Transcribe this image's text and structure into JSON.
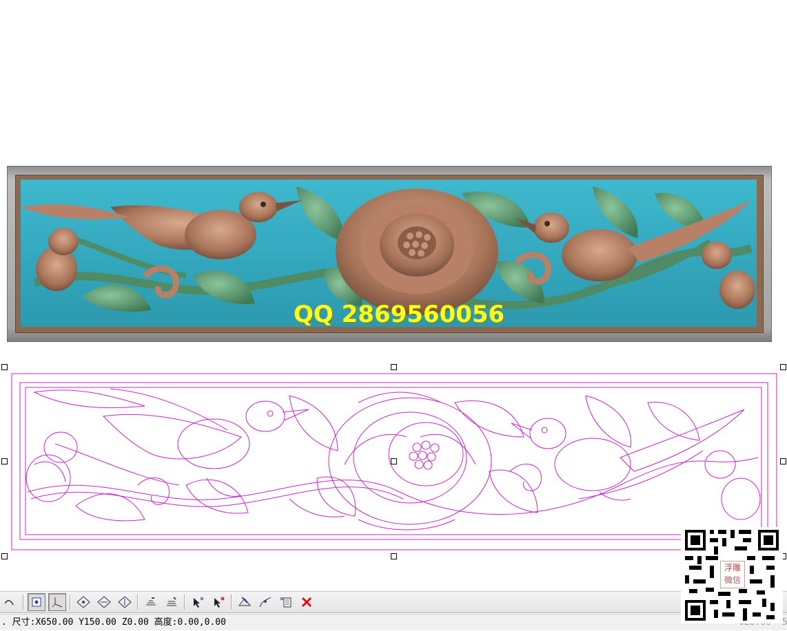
{
  "watermark": {
    "text": "QQ 2869560056",
    "color": "#ffff1a"
  },
  "relief": {
    "frame_color": "#8c6a52",
    "background_color": "#3fb9cf",
    "carving_color": "#b7856a",
    "leaf_color": "#5f9c72"
  },
  "vector": {
    "stroke_color": "#cc22cc"
  },
  "qr_code": {
    "label_line1": "浮雕",
    "label_line2": "微信"
  },
  "toolbar": {
    "buttons": [
      {
        "name": "curve-tool-icon",
        "active": false
      },
      {
        "name": "snap-point-icon",
        "active": true
      },
      {
        "name": "axis-icon",
        "active": true
      },
      {
        "name": "diamond-node-icon",
        "active": false
      },
      {
        "name": "diamond-edit-icon",
        "active": false
      },
      {
        "name": "diamond-transform-icon",
        "active": false
      },
      {
        "name": "layer-stack-icon",
        "active": false
      },
      {
        "name": "layer-edit-icon",
        "active": false
      },
      {
        "name": "select-cross-icon",
        "active": false
      },
      {
        "name": "select-delete-icon",
        "active": false
      },
      {
        "name": "node-edit-icon",
        "active": false
      },
      {
        "name": "path-edit-icon",
        "active": false
      },
      {
        "name": "document-edit-icon",
        "active": false
      },
      {
        "name": "delete-icon",
        "active": false
      }
    ]
  },
  "status": {
    "dimensions_text": ". 尺寸:X650.00 Y150.00 Z0.00 高度:0.00,0.00",
    "right_text": "628.60 -5"
  }
}
